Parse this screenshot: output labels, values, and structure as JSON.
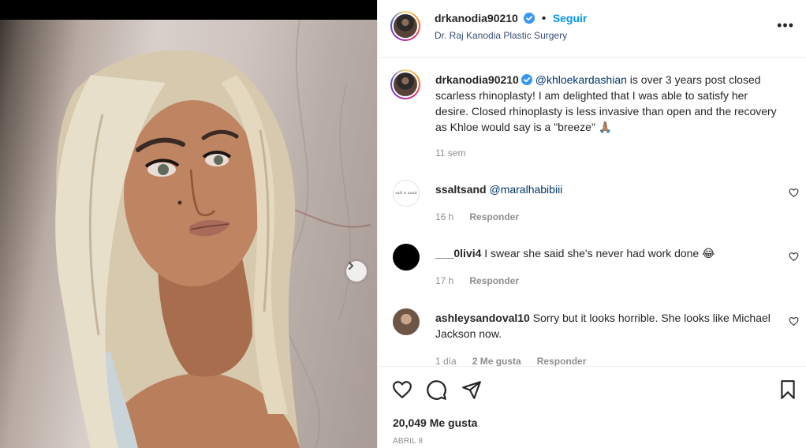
{
  "post": {
    "username": "drkanodia90210",
    "follow_label": "Seguir",
    "subtitle": "Dr. Raj Kanodia Plastic Surgery",
    "more_label": "•••"
  },
  "caption": {
    "username": "drkanodia90210",
    "mention": "@khloekardashian",
    "text": " is over 3 years post closed scarless rhinoplasty! I am delighted that I was able to satisfy her desire. Closed rhinoplasty is less invasive than open and the recovery as Khloe would say is a \"breeze\" 🙏🏽",
    "time": "11 sem"
  },
  "comments": [
    {
      "username": "ssaltsand",
      "text": "@maralhabibiii",
      "time": "16 h",
      "reply_label": "Responder",
      "avatar_text": "salt n sand"
    },
    {
      "username": "___0livi4",
      "text": " I swear she said she's never had work done 😂",
      "time": "17 h",
      "reply_label": "Responder"
    },
    {
      "username": "ashleysandoval10",
      "text": " Sorry but it looks horrible. She looks like Michael Jackson now.",
      "time": "1 día",
      "likes_label": "2 Me gusta",
      "reply_label": "Responder"
    }
  ],
  "footer": {
    "likes": "20,049 Me gusta",
    "date": "ABRIL 8"
  },
  "colors": {
    "follow": "#0095f6",
    "verified": "#3897f0",
    "mention": "#00376b",
    "muted": "#8e8e8e"
  },
  "icons": [
    "verified-icon",
    "more-options-icon",
    "heart-icon",
    "comment-icon",
    "share-icon",
    "bookmark-icon",
    "chevron-right-icon"
  ]
}
